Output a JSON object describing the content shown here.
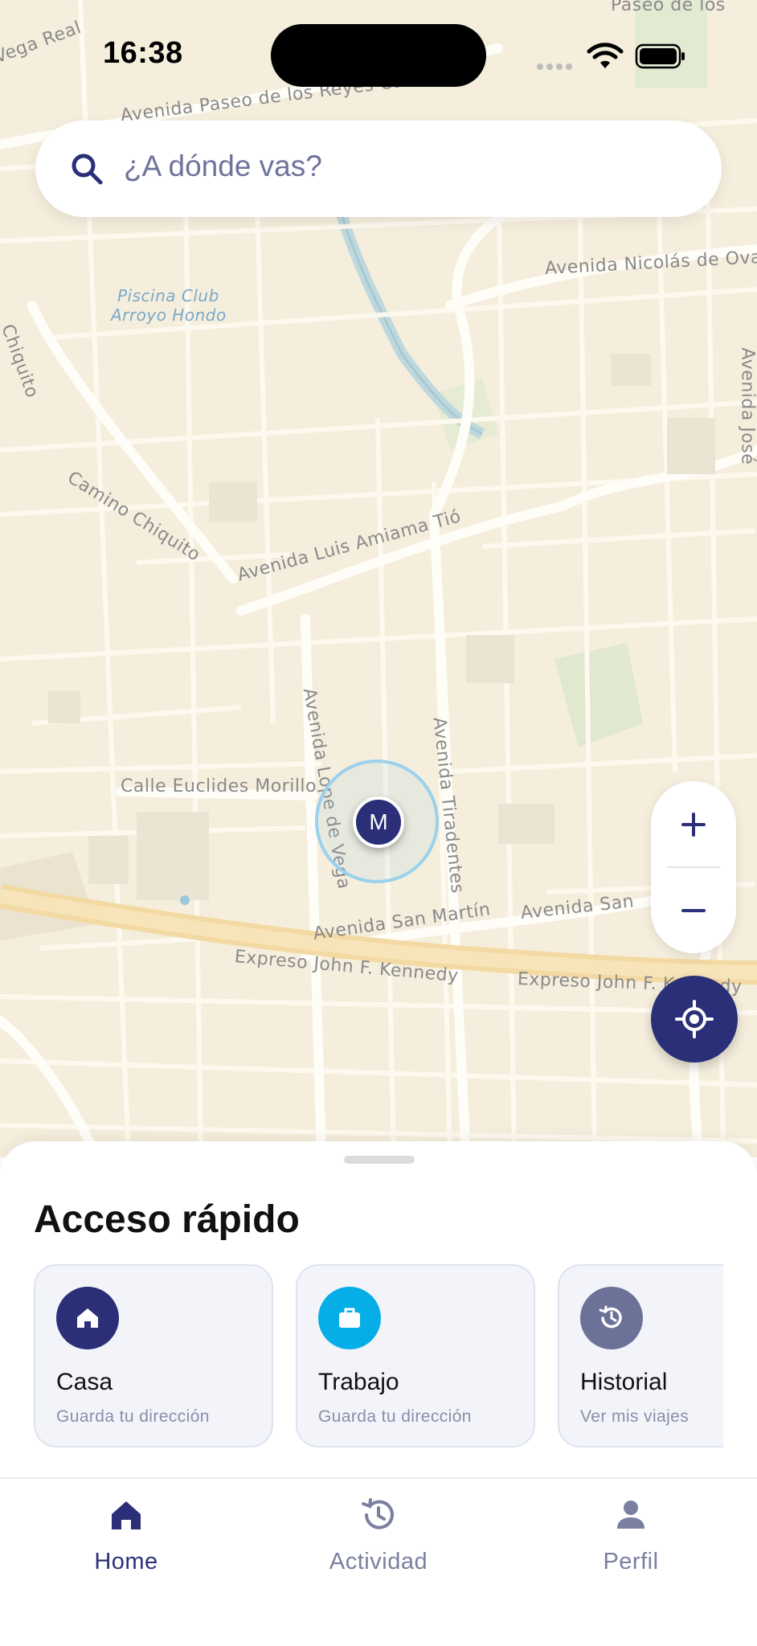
{
  "status_bar": {
    "time": "16:38"
  },
  "search": {
    "placeholder": "¿A dónde vas?"
  },
  "map": {
    "labels": {
      "street1": "Avenida Paseo de los Reyes Católicos",
      "street2": "Avenida Nicolás de Ovando",
      "pool": "Piscina Club",
      "pool2": "Arroyo Hondo",
      "chiquito": "Chiquito",
      "camino": "Camino Chiquito",
      "luis": "Avenida Luis Amiama Tió",
      "lope": "Avenida Lope de Vega",
      "tiradentes": "Avenida Tiradentes",
      "euclides": "Calle Euclides Morillo",
      "sanmartin": "Avenida San Martín",
      "sanmartin2": "Avenida San",
      "kennedy": "Expreso John F. Kennedy",
      "kennedy2": "Expreso John F. Kennedy",
      "topleft": "Vega Real",
      "topright": "Paseo de los",
      "jose": "Avenida José"
    },
    "marker_initial": "M"
  },
  "zoom": {
    "in": "+",
    "out": "−"
  },
  "icons": {
    "search": "search-icon",
    "locate": "crosshair-icon",
    "home": "home-icon",
    "work": "briefcase-icon",
    "history": "history-icon",
    "profile": "person-icon"
  },
  "quick_access": {
    "title": "Acceso rápido",
    "cards": [
      {
        "title": "Casa",
        "subtitle": "Guarda tu dirección",
        "color": "#2a2f78"
      },
      {
        "title": "Trabajo",
        "subtitle": "Guarda tu dirección",
        "color": "#06aee8"
      },
      {
        "title": "Historial",
        "subtitle": "Ver mis viajes",
        "color": "#6c7197"
      }
    ]
  },
  "bottom_nav": {
    "items": [
      {
        "label": "Home",
        "active": true
      },
      {
        "label": "Actividad",
        "active": false
      },
      {
        "label": "Perfil",
        "active": false
      }
    ],
    "active_color": "#2a2f78",
    "inactive_color": "#7b7fa0"
  }
}
